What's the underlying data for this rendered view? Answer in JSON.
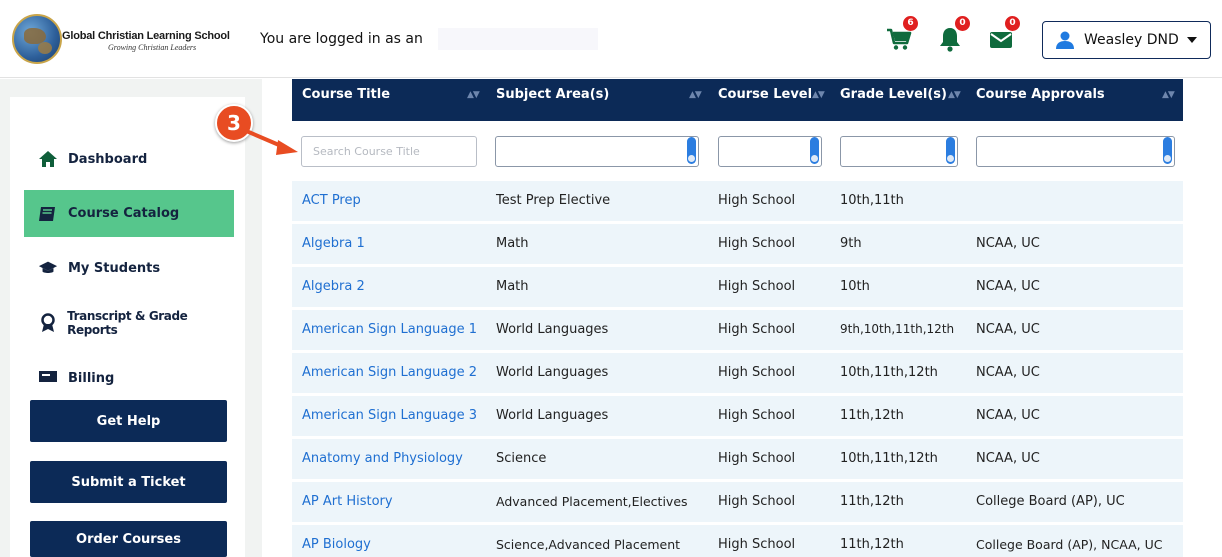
{
  "header": {
    "school_name": "Global Christian Learning School",
    "school_tagline": "Growing Christian Leaders",
    "logged_in_text": "You are logged in as an",
    "cart_count": "6",
    "notifications_count": "0",
    "messages_count": "0",
    "user_name": "Weasley DND"
  },
  "sidebar": {
    "items": [
      {
        "label": "Dashboard",
        "icon": "home-icon"
      },
      {
        "label": "Course Catalog",
        "icon": "book-icon"
      },
      {
        "label": "My Students",
        "icon": "graduation-cap-icon"
      },
      {
        "label": "Transcript & Grade Reports",
        "icon": "award-icon"
      },
      {
        "label": "Billing",
        "icon": "billing-icon"
      }
    ],
    "buttons": {
      "help": "Get Help",
      "ticket": "Submit a Ticket",
      "order": "Order Courses"
    }
  },
  "callout": {
    "number": "3"
  },
  "table": {
    "columns": [
      "Course Title",
      "Subject Area(s)",
      "Course Level",
      "Grade Level(s)",
      "Course Approvals"
    ],
    "search_placeholder": "Search Course Title",
    "rows": [
      [
        "ACT Prep",
        "Test Prep Elective",
        "High School",
        "10th,11th",
        ""
      ],
      [
        "Algebra 1",
        "Math",
        "High School",
        "9th",
        "NCAA, UC"
      ],
      [
        "Algebra 2",
        "Math",
        "High School",
        "10th",
        "NCAA, UC"
      ],
      [
        "American Sign Language 1",
        "World Languages",
        "High School",
        "9th,10th,11th,12th",
        "NCAA, UC"
      ],
      [
        "American Sign Language 2",
        "World Languages",
        "High School",
        "10th,11th,12th",
        "NCAA, UC"
      ],
      [
        "American Sign Language 3",
        "World Languages",
        "High School",
        "11th,12th",
        "NCAA, UC"
      ],
      [
        "Anatomy and Physiology",
        "Science",
        "High School",
        "10th,11th,12th",
        "NCAA, UC"
      ],
      [
        "AP Art History",
        "Advanced Placement,Electives",
        "High School",
        "11th,12th",
        "College Board (AP), UC"
      ],
      [
        "AP Biology",
        "Science,Advanced Placement",
        "High School",
        "11th,12th",
        "College Board (AP), NCAA, UC"
      ]
    ]
  },
  "colors": {
    "navy": "#0c2a57",
    "active_green": "#56c68c",
    "link_blue": "#1f6fd1",
    "row_bg": "#edf5fa",
    "badge_red": "#e01f1f",
    "callout_orange": "#e84c22"
  }
}
